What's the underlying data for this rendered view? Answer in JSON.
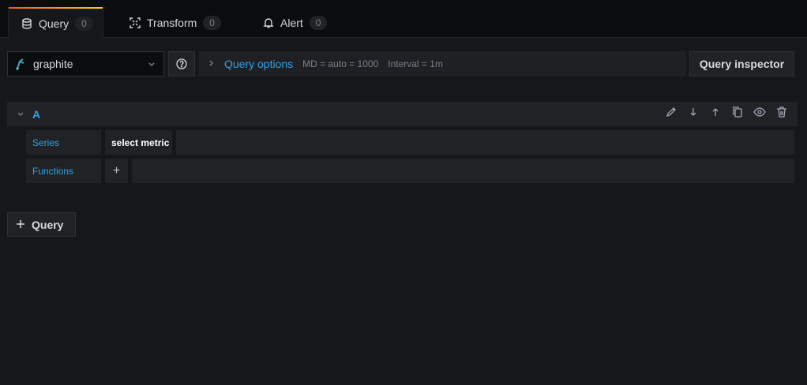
{
  "tabs": [
    {
      "label": "Query",
      "count": "0",
      "icon": "database-icon",
      "active": true
    },
    {
      "label": "Transform",
      "count": "0",
      "icon": "transform-icon"
    },
    {
      "label": "Alert",
      "count": "0",
      "icon": "bell-icon"
    }
  ],
  "toolbar": {
    "datasource": "graphite",
    "query_options_label": "Query options",
    "max_data_points": "MD = auto = 1000",
    "interval": "Interval = 1m",
    "query_inspector_label": "Query inspector"
  },
  "query": {
    "ref_id": "A",
    "series_label": "Series",
    "series_value": "select metric",
    "functions_label": "Functions",
    "add_function": "+"
  },
  "add_query_label": "Query",
  "colors": {
    "accent": "#33a2e5",
    "tab_gradient_start": "#f05a28",
    "tab_gradient_end": "#fbca0a"
  }
}
